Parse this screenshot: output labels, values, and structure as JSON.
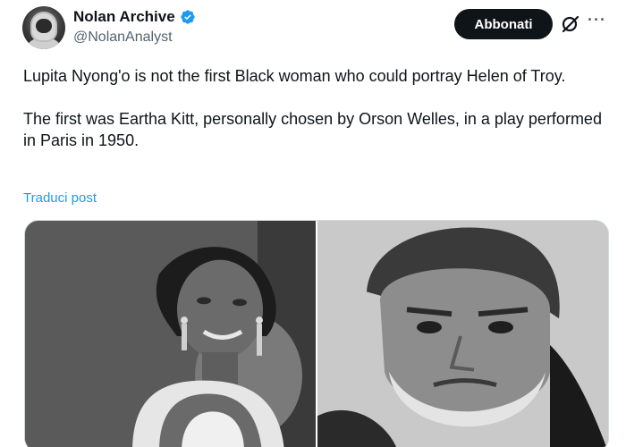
{
  "user": {
    "display_name": "Nolan Archive",
    "handle": "@NolanAnalyst",
    "verified": true,
    "avatar_icon": "astronaut-avatar"
  },
  "header": {
    "subscribe_label": "Abbonati",
    "grok_icon": "grok-icon",
    "more_icon": "more-icon",
    "more_glyph": "···"
  },
  "tweet": {
    "paragraph_1": "Lupita Nyong'o is not the first Black woman who could portray Helen of Troy.",
    "paragraph_2": "The first was Eartha Kitt, personally chosen by Orson Welles, in a play performed in Paris in 1950.",
    "translate_label": "Traduci post"
  },
  "media": {
    "photos": [
      {
        "icon": "photo-woman-portrait"
      },
      {
        "icon": "photo-bearded-man-portrait"
      }
    ]
  },
  "colors": {
    "link": "#1d9bf0",
    "verified": "#1d9bf0",
    "button_bg": "#0f1419",
    "secondary_text": "#536471"
  }
}
